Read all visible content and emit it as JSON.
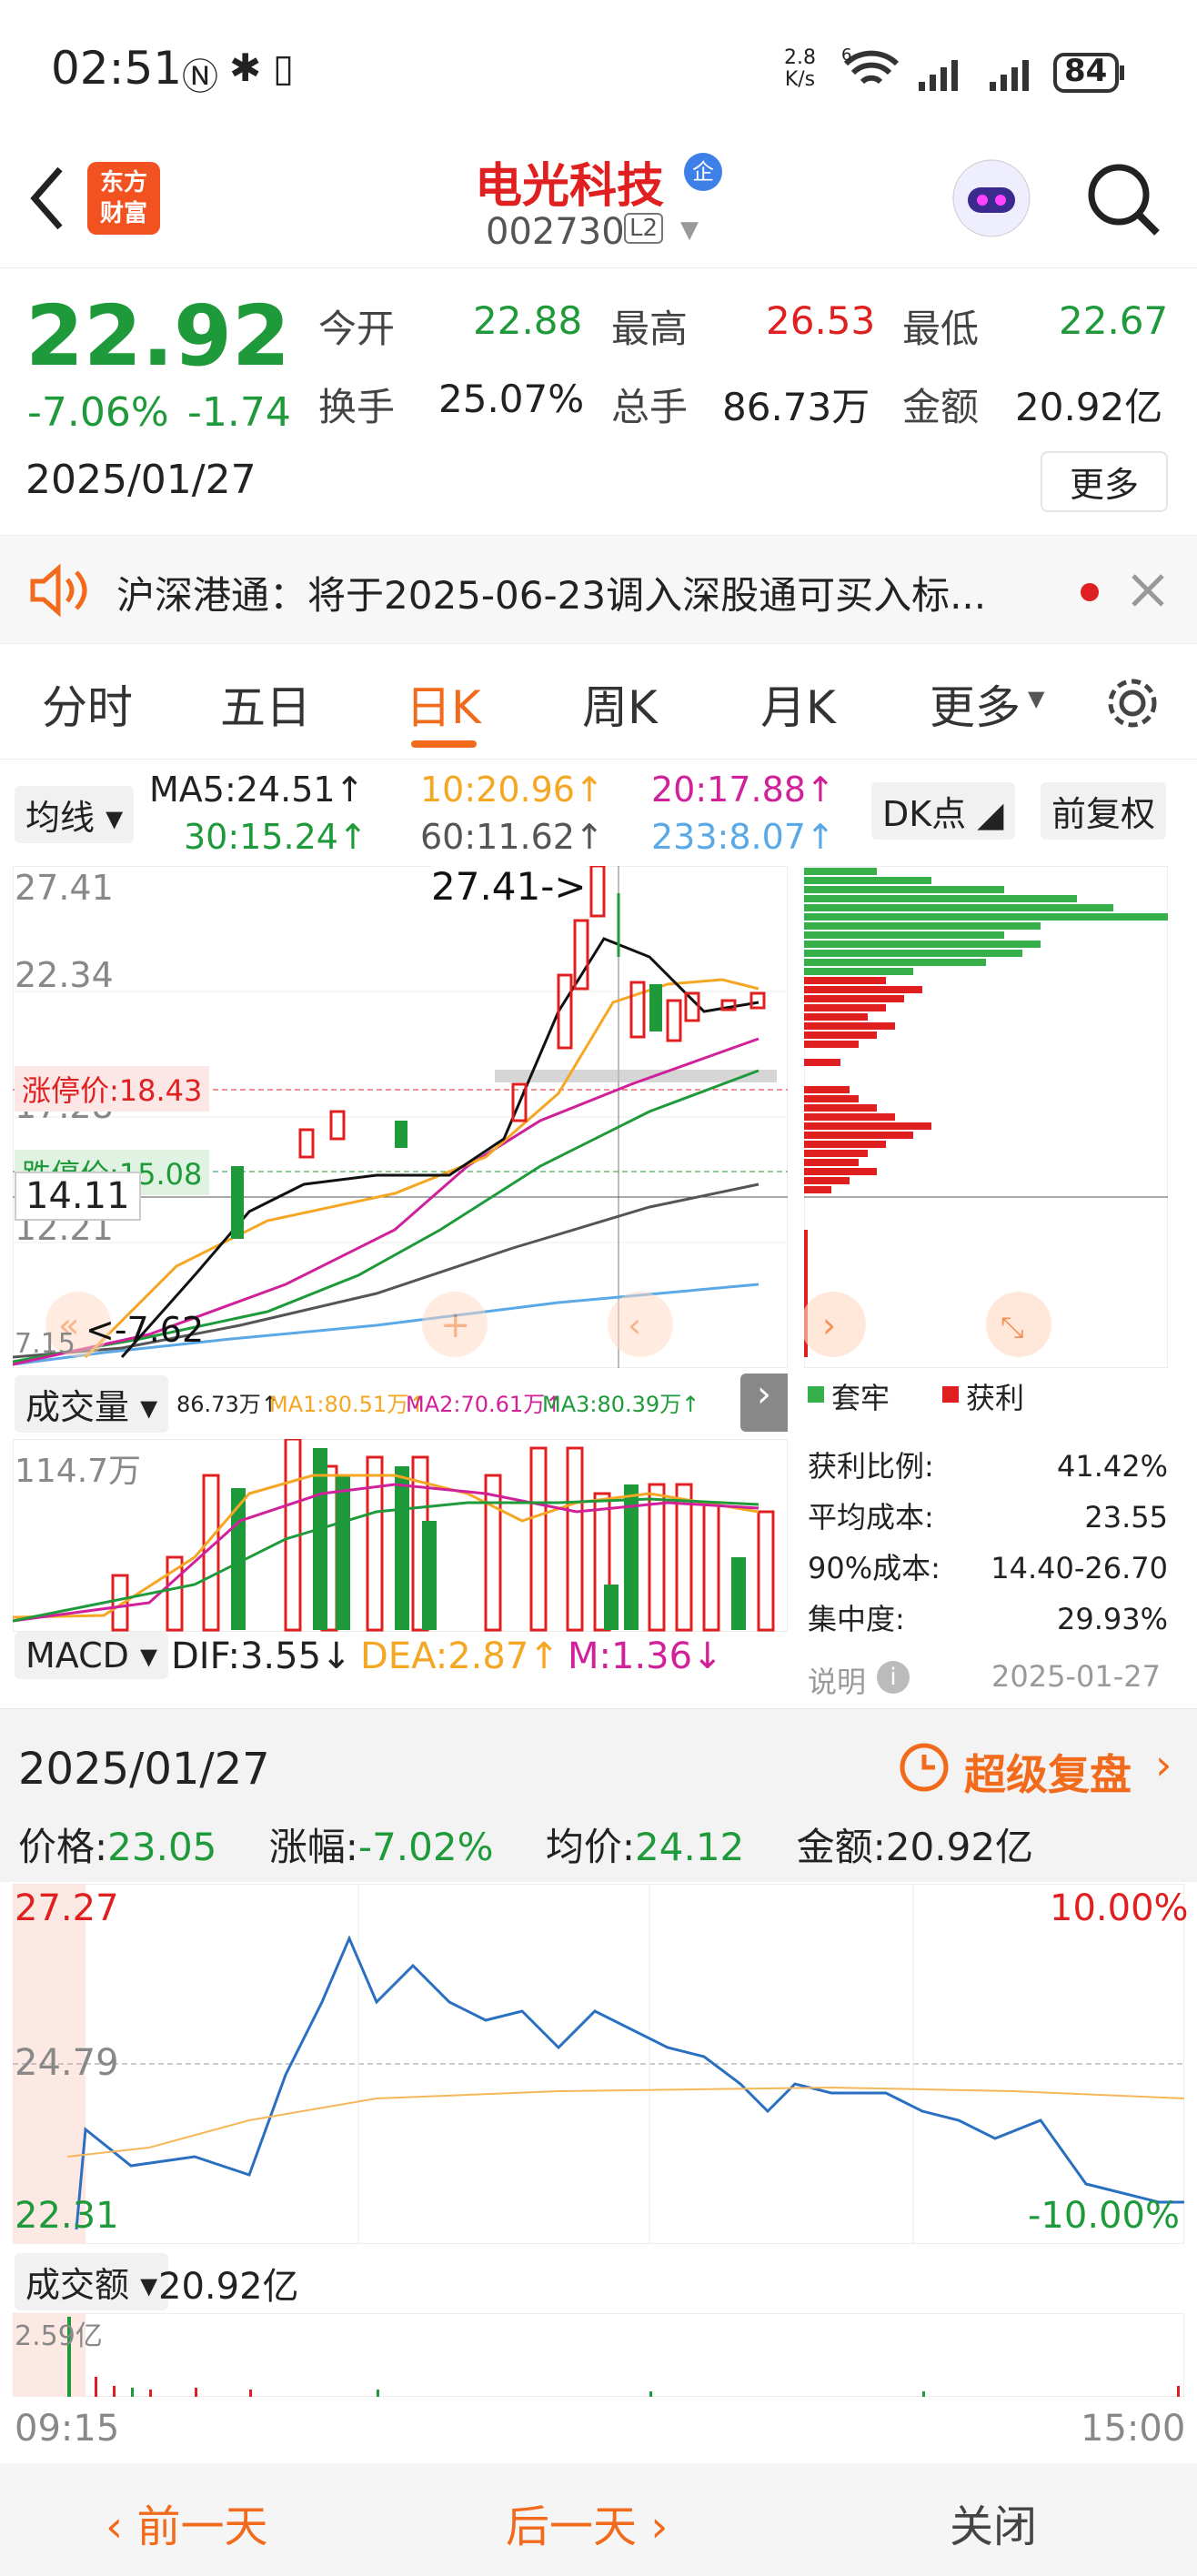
{
  "status": {
    "time": "02:51",
    "net_speed_top": "2.8",
    "net_speed_bottom": "K/s",
    "wifi_sup": "6",
    "battery": "84"
  },
  "header": {
    "stock_name": "电光科技",
    "badge": "企",
    "code": "002730",
    "level_badge": "L2",
    "brand_line1": "东方",
    "brand_line2": "财富"
  },
  "quote": {
    "price": "22.92",
    "change_pct": "-7.06%",
    "change": "-1.74",
    "date": "2025/01/27",
    "open_label": "今开",
    "open": "22.88",
    "high_label": "最高",
    "high": "26.53",
    "low_label": "最低",
    "low": "22.67",
    "turnover_label": "换手",
    "turnover": "25.07%",
    "volume_label": "总手",
    "volume": "86.73万",
    "amount_label": "金额",
    "amount": "20.92亿",
    "more": "更多"
  },
  "notice": {
    "text": "沪深港通：将于2025-06-23调入深股通可买入标..."
  },
  "tabs": [
    {
      "label": "分时"
    },
    {
      "label": "五日"
    },
    {
      "label": "日K",
      "active": true
    },
    {
      "label": "周K"
    },
    {
      "label": "月K"
    },
    {
      "label": "更多"
    }
  ],
  "kline": {
    "ma_selector": "均线",
    "ma5": "MA5:24.51↑",
    "ma10": "10:20.96↑",
    "ma20": "20:17.88↑",
    "ma30": "30:15.24↑",
    "ma60": "60:11.62↑",
    "ma233": "233:8.07↑",
    "dk": "DK点",
    "fq": "前复权",
    "y_ticks": [
      "27.41",
      "22.34",
      "17.28",
      "12.21",
      "7.15"
    ],
    "high_mark": "27.41->",
    "low_mark": "<-7.62",
    "limit_up": "涨停价:18.43",
    "limit_down": "跌停价:15.08",
    "cursor_value": "14.11",
    "vol_selector": "成交量",
    "vol_now": "86.73万↑",
    "vol_ma1": "MA1:80.51万↑",
    "vol_ma2": "MA2:70.61万↑",
    "vol_ma3": "MA3:80.39万↑",
    "vol_max": "114.7万",
    "macd_selector": "MACD",
    "dif": "DIF:3.55↓",
    "dea": "DEA:2.87↑",
    "m": "M:1.36↓",
    "chip_legend_locked": "套牢",
    "chip_legend_profit": "获利",
    "chip_stats": [
      {
        "k": "获利比例:",
        "v": "41.42%"
      },
      {
        "k": "平均成本:",
        "v": "23.55"
      },
      {
        "k": "90%成本:",
        "v": "14.40-26.70"
      },
      {
        "k": "集中度:",
        "v": "29.93%"
      }
    ],
    "chip_note": "说明",
    "chip_date": "2025-01-27"
  },
  "popup": {
    "date": "2025/01/27",
    "replay": "超级复盘",
    "price_label": "价格:",
    "price": "23.05",
    "pct_label": "涨幅:",
    "pct": "-7.02%",
    "avg_label": "均价:",
    "avg": "24.12",
    "amt_label": "金额:",
    "amt": "20.92亿",
    "y_top": "27.27",
    "y_mid": "24.79",
    "y_bot": "22.31",
    "pct_top": "10.00%",
    "pct_bot": "-10.00%",
    "amount_selector": "成交额",
    "amount_value": "20.92亿",
    "amount_max": "2.59亿",
    "time_start": "09:15",
    "time_end": "15:00"
  },
  "bottom": {
    "prev": "前一天",
    "next": "后一天",
    "close": "关闭"
  },
  "colors": {
    "up": "#e02020",
    "down": "#1f9a3a",
    "accent": "#ff6a00",
    "link": "#2a79c7"
  }
}
